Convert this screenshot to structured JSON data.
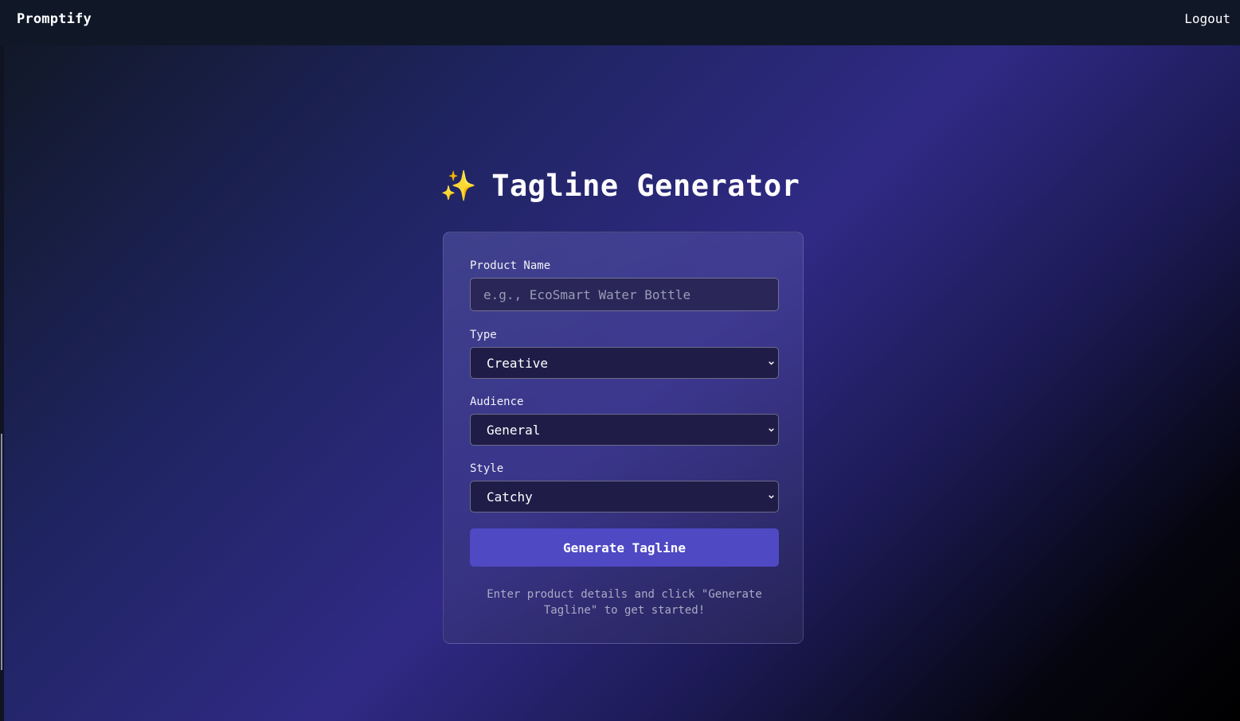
{
  "header": {
    "brand": "Promptify",
    "logout_label": "Logout"
  },
  "page": {
    "title_icon": "✨",
    "title": "Tagline Generator"
  },
  "form": {
    "product_name": {
      "label": "Product Name",
      "value": "",
      "placeholder": "e.g., EcoSmart Water Bottle"
    },
    "type": {
      "label": "Type",
      "selected": "Creative"
    },
    "audience": {
      "label": "Audience",
      "selected": "General"
    },
    "style": {
      "label": "Style",
      "selected": "Catchy"
    },
    "generate_label": "Generate Tagline",
    "hint": "Enter product details and click \"Generate Tagline\" to get started!"
  },
  "colors": {
    "topbar": "#101828",
    "button": "#4f49c4",
    "title_icon": "#f7c948"
  },
  "icons": {
    "title": "sparkles-icon",
    "select": "chevron-down-icon"
  }
}
